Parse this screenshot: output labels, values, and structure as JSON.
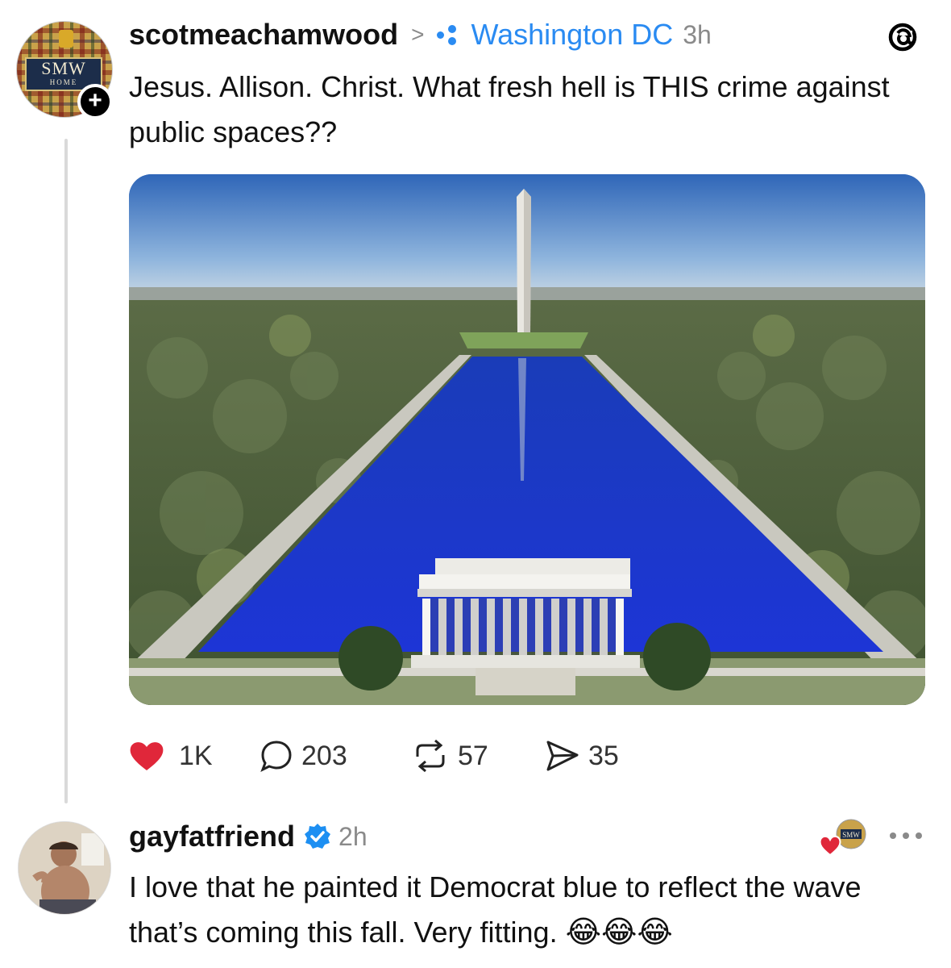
{
  "post": {
    "username": "scotmeachamwood",
    "separator": ">",
    "location": "Washington DC",
    "time": "3h",
    "text": "Jesus. Allison. Christ. What fresh hell is THIS crime against public spaces??",
    "avatar_text": "SMW",
    "avatar_subtext": "HOME",
    "follow_label": "+"
  },
  "actions": {
    "likes": "1K",
    "replies": "203",
    "reposts": "57",
    "shares": "35"
  },
  "reply": {
    "username": "gayfatfriend",
    "time": "2h",
    "text": "I love that he painted it Democrat blue to reflect the wave that’s coming this fall. Very fitting.",
    "emojis": "😂😂😂",
    "liked_by_text": "SMW"
  },
  "colors": {
    "accent": "#2a8bf2",
    "like": "#e0273a",
    "pool": "#1d3fc4"
  },
  "icons": [
    "chevron-right-icon",
    "location-pin-icon",
    "threads-logo-icon",
    "heart-icon",
    "comment-icon",
    "repost-icon",
    "share-icon",
    "verified-badge-icon",
    "more-icon"
  ]
}
